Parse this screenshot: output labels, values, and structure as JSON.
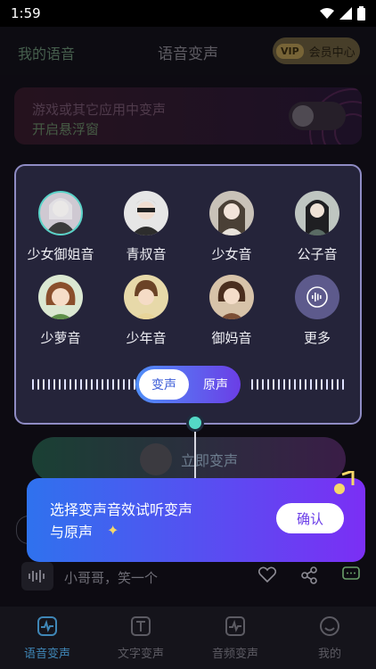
{
  "status": {
    "time": "1:59"
  },
  "header": {
    "left_link": "我的语音",
    "title": "语音变声",
    "vip_tag": "VIP",
    "vip_label": "会员中心"
  },
  "banner": {
    "line1": "游戏或其它应用中变声",
    "line2": "开启悬浮窗"
  },
  "voices": [
    {
      "name": "少女御姐音",
      "icon": "female-mature-avatar-icon"
    },
    {
      "name": "青叔音",
      "icon": "young-uncle-avatar-icon"
    },
    {
      "name": "少女音",
      "icon": "young-girl-avatar-icon"
    },
    {
      "name": "公子音",
      "icon": "young-master-avatar-icon"
    },
    {
      "name": "少萝音",
      "icon": "little-girl-avatar-icon"
    },
    {
      "name": "少年音",
      "icon": "boy-avatar-icon"
    },
    {
      "name": "御妈音",
      "icon": "mature-mother-avatar-icon"
    },
    {
      "name": "更多",
      "icon": "sound-wave-icon"
    }
  ],
  "segment": {
    "on": "变声",
    "off": "原声"
  },
  "action": {
    "label": "立即变声"
  },
  "tip": {
    "line1": "选择变声音效试听变声",
    "line2": "与原声",
    "confirm": "确认"
  },
  "player": {
    "text": "小哥哥，笑一个"
  },
  "nav": [
    {
      "label": "语音变声",
      "active": true
    },
    {
      "label": "文字变声",
      "active": false
    },
    {
      "label": "音频变声",
      "active": false
    },
    {
      "label": "我的",
      "active": false
    }
  ],
  "colors": {
    "accent_blue": "#3f86b6",
    "panel_border": "#8f8cc4",
    "tip_start": "#2f72ee",
    "tip_end": "#7b2ff4"
  }
}
